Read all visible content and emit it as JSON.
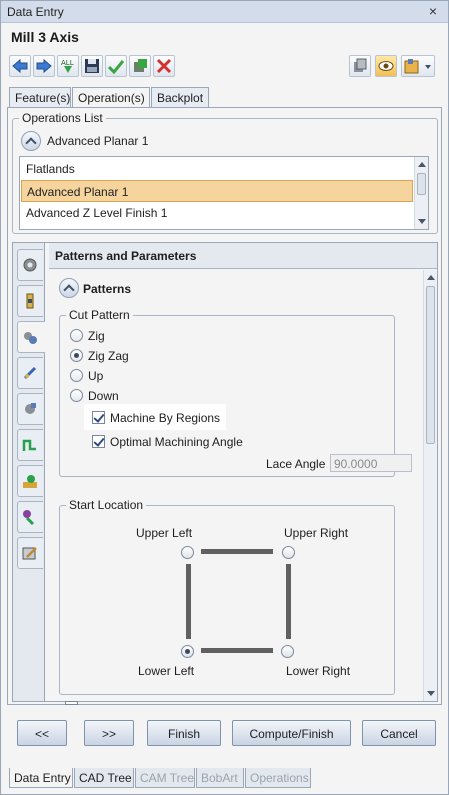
{
  "window": {
    "title": "Data Entry",
    "close_glyph": "×"
  },
  "heading": "Mill 3 Axis",
  "toolbar": {
    "left_icons": [
      "arrow-left-icon",
      "arrow-right-icon",
      "all-down-icon",
      "save-icon",
      "checkmark-icon",
      "machine-icon",
      "delete-icon"
    ],
    "right_icons": [
      "stock-icon",
      "eye-icon",
      "tool-icon"
    ]
  },
  "top_tabs": [
    "Feature(s)",
    "Operation(s)",
    "Backplot"
  ],
  "operations": {
    "group_label": "Operations List",
    "current": "Advanced Planar 1",
    "items": [
      "Flatlands",
      "Advanced Planar 1",
      "Advanced Z Level Finish 1"
    ]
  },
  "params": {
    "header": "Patterns and Parameters",
    "section": "Patterns",
    "cut_pattern": {
      "label": "Cut Pattern",
      "options": [
        "Zig",
        "Zig Zag",
        "Up",
        "Down"
      ],
      "selected": "Zig Zag"
    },
    "machine_by_regions": {
      "label": "Machine By Regions",
      "checked": true
    },
    "optimal_angle": {
      "label": "Optimal Machining Angle",
      "checked": true
    },
    "lace_angle": {
      "label": "Lace Angle",
      "value": "90.0000"
    },
    "start_location": {
      "label": "Start Location",
      "upper_left": "Upper Left",
      "upper_right": "Upper Right",
      "lower_left": "Lower Left",
      "lower_right": "Lower Right",
      "selected": "Lower Left"
    }
  },
  "buttons": {
    "prev": "<<",
    "next": ">>",
    "finish": "Finish",
    "compute_finish": "Compute/Finish",
    "cancel": "Cancel"
  },
  "bottom_tabs": [
    "Data Entry",
    "CAD Tree",
    "CAM Tree",
    "BobArt",
    "Operations"
  ]
}
